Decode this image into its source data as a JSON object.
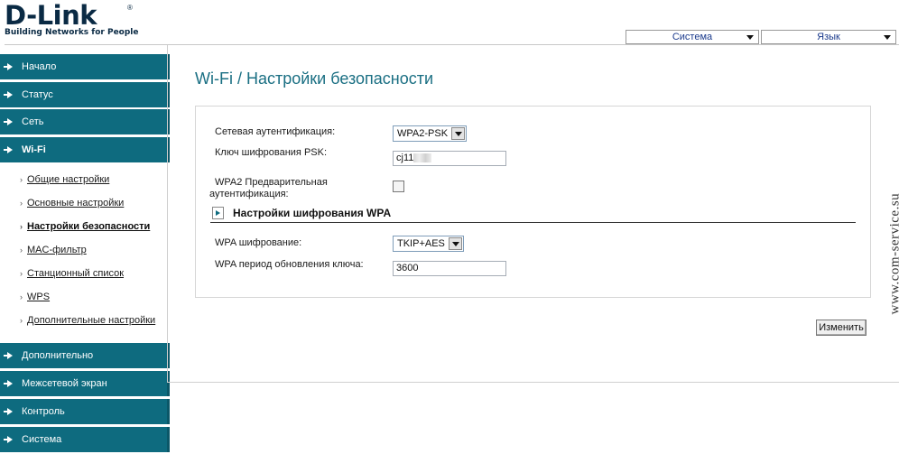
{
  "brand": {
    "name": "D-Link",
    "tm": "®",
    "tagline": "Building Networks for People"
  },
  "top": {
    "system_menu": "Система",
    "language_menu": "Язык"
  },
  "sidebar": {
    "items": [
      {
        "label": "Начало"
      },
      {
        "label": "Статус"
      },
      {
        "label": "Сеть"
      },
      {
        "label": "Wi-Fi"
      },
      {
        "label": "Дополнительно"
      },
      {
        "label": "Межсетевой экран"
      },
      {
        "label": "Контроль"
      },
      {
        "label": "Система"
      }
    ],
    "wifi_sub": [
      {
        "label": "Общие настройки"
      },
      {
        "label": "Основные настройки"
      },
      {
        "label": "Настройки безопасности",
        "active": true
      },
      {
        "label": "MAC-фильтр"
      },
      {
        "label": "Станционный список"
      },
      {
        "label": "WPS"
      },
      {
        "label": "Дополнительные настройки"
      }
    ]
  },
  "page": {
    "title": "Wi-Fi / Настройки безопасности"
  },
  "form": {
    "auth_label": "Сетевая аутентификация:",
    "auth_value": "WPA2-PSK",
    "psk_label": "Ключ шифрования PSK:",
    "psk_value": "cj11",
    "preauth_label_1": "WPA2 Предварительная",
    "preauth_label_2": "аутентификация:",
    "section_title": "Настройки шифрования WPA",
    "cipher_label": "WPA шифрование:",
    "cipher_value": "TKIP+AES",
    "rekey_label": "WPA период обновления ключа:",
    "rekey_value": "3600",
    "apply_label": "Изменить"
  },
  "watermark": "www.com-service.su"
}
